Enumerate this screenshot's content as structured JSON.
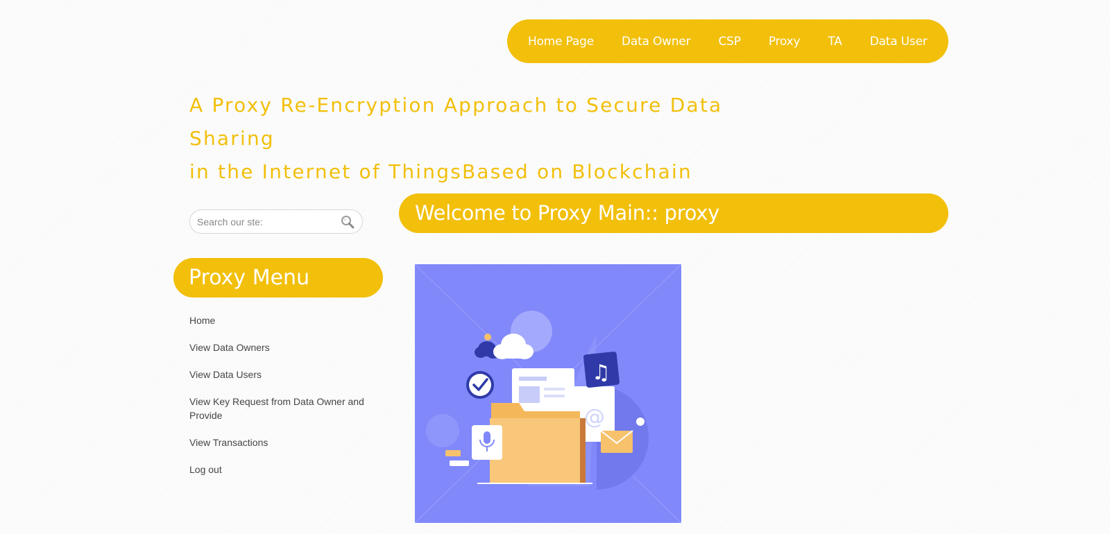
{
  "nav": {
    "items": [
      "Home Page",
      "Data Owner",
      "CSP",
      "Proxy",
      "TA",
      "Data User"
    ]
  },
  "site": {
    "title_line1": "A Proxy Re-Encryption Approach to Secure Data Sharing",
    "title_line2": "in the Internet of ThingsBased on Blockchain"
  },
  "search": {
    "placeholder": "Search our ste:",
    "value": "",
    "icon": "search-icon"
  },
  "sidebar": {
    "heading": "Proxy Menu",
    "items": [
      "Home",
      "View Data Owners",
      "View Data Users",
      "View Key Request from Data Owner and Provide",
      "View Transactions",
      "Log out"
    ]
  },
  "main": {
    "heading": "Welcome to Proxy Main:: proxy"
  },
  "colors": {
    "accent": "#f2bf0a",
    "illustration_bg": "#8088fa",
    "text": "#444444"
  }
}
